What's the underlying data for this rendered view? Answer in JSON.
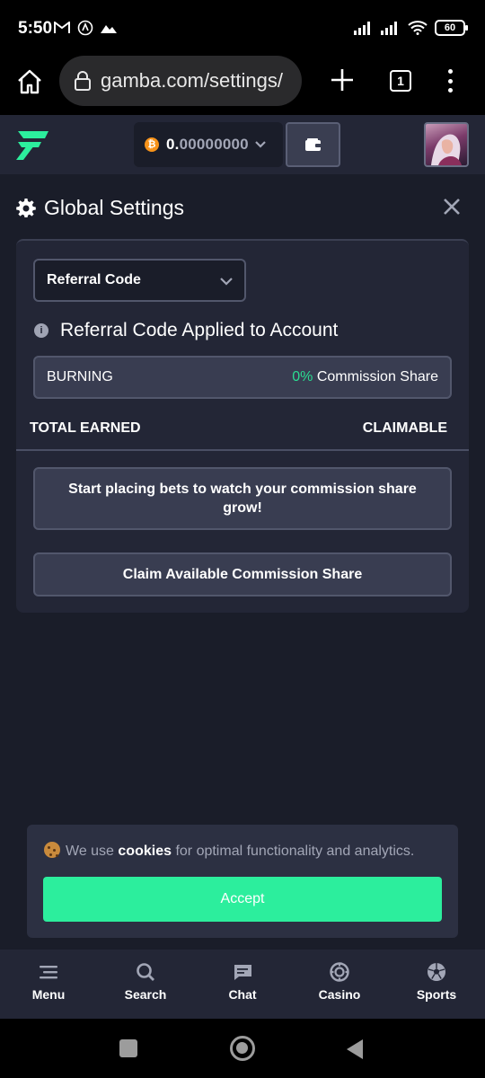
{
  "status_bar": {
    "time": "5:50",
    "battery": "60"
  },
  "browser": {
    "url": "gamba.com/settings/",
    "tab_count": "1"
  },
  "topnav": {
    "balance_int": "0.",
    "balance_dec": "00000000",
    "currency_icon": "bitcoin-icon"
  },
  "settings": {
    "title": "Global Settings"
  },
  "panel": {
    "dropdown_selected": "Referral Code",
    "applied_text": "Referral Code Applied to Account",
    "code_name": "BURNING",
    "share_pct": "0%",
    "share_label": " Commission Share",
    "total_earned_label": "TOTAL EARNED",
    "claimable_label": "CLAIMABLE",
    "info_text": "Start placing bets to watch your commission share grow!",
    "claim_button": "Claim Available Commission Share"
  },
  "cookie": {
    "text_before": "We use ",
    "text_link": "cookies",
    "text_after": " for optimal functionality and analytics.",
    "accept_label": "Accept"
  },
  "bottom_nav": {
    "items": [
      {
        "label": "Menu",
        "icon": "menu-icon"
      },
      {
        "label": "Search",
        "icon": "search-icon"
      },
      {
        "label": "Chat",
        "icon": "chat-icon"
      },
      {
        "label": "Casino",
        "icon": "casino-chip-icon"
      },
      {
        "label": "Sports",
        "icon": "soccer-ball-icon"
      }
    ]
  },
  "colors": {
    "accent_green": "#2cee9d",
    "share_green": "#2bdc91",
    "bg": "#1a1d29",
    "panel": "#232636"
  }
}
